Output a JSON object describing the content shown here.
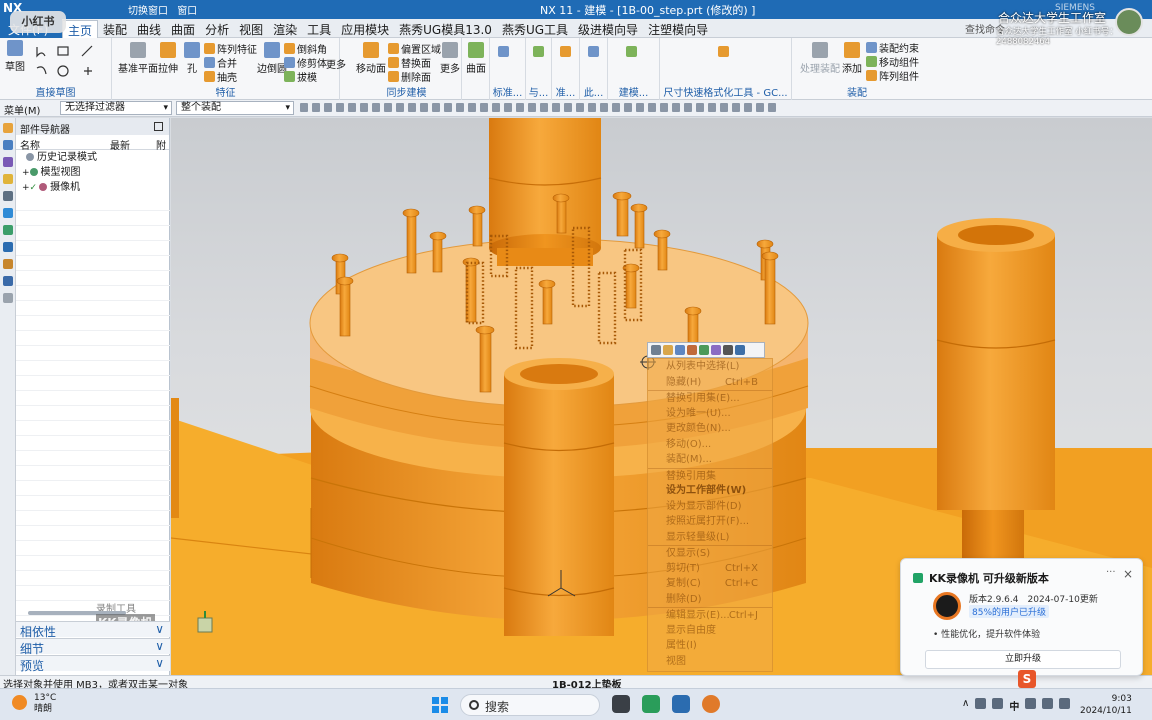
{
  "titlebar": {
    "logo": "NX",
    "quick_access": [
      "切换窗口",
      "窗口"
    ],
    "title": "NX 11 - 建模 - [1B-00_step.prt  (修改的) ]",
    "brand": "SIEMENS"
  },
  "menu": {
    "file": "文件(F)",
    "tabs": [
      {
        "label": "主页",
        "active": true
      },
      {
        "label": "装配"
      },
      {
        "label": "曲线"
      },
      {
        "label": "曲面"
      },
      {
        "label": "分析"
      },
      {
        "label": "视图"
      },
      {
        "label": "渲染"
      },
      {
        "label": "工具"
      },
      {
        "label": "应用模块"
      },
      {
        "label": "燕秀UG模具13.0"
      },
      {
        "label": "燕秀UG工具"
      },
      {
        "label": "级进模向导"
      },
      {
        "label": "注塑模向导"
      }
    ],
    "find_command": "查找命令"
  },
  "ribbon": {
    "sketch_group": {
      "name": "直接草图",
      "sketch": "草图"
    },
    "feature_group": {
      "name": "特征",
      "datum_plane": "基准平面",
      "extrude": "拉伸",
      "hole": "孔",
      "pattern_feature": "阵列特征",
      "unite": "合并",
      "shell": "抽壳",
      "edge_blend": "边倒圆",
      "chamfer": "倒斜角",
      "trim_body": "修剪体",
      "draft": "拔模",
      "more": "更多"
    },
    "sync_group": {
      "name": "同步建模",
      "move_face": "移动面",
      "offset_region": "偏置区域",
      "replace_face": "替换面",
      "delete_face": "删除面",
      "more": "更多"
    },
    "surface_group": {
      "surface": "曲面"
    },
    "small_groups": [
      "标准...",
      "与...",
      "准...",
      "此...",
      "建模...",
      "尺寸快速格式化工具 - GC..."
    ],
    "assembly_group": {
      "name": "装配",
      "wave": "WAVE",
      "process_assembly": "处理装配",
      "add": "添加",
      "assembly_constraints": "装配约束",
      "move_component": "移动组件",
      "pattern_component": "阵列组件"
    }
  },
  "selbar": {
    "menu": "菜单(M)",
    "filter": "无选择过滤器",
    "scope": "整个装配"
  },
  "navigator": {
    "title": "部件导航器",
    "columns": {
      "name": "名称",
      "latest": "最新",
      "attached": "附"
    },
    "rows": [
      {
        "label": "历史记录模式"
      },
      {
        "label": "模型视图"
      },
      {
        "label": "摄像机"
      }
    ],
    "watermark_top": "录制工具",
    "watermark_bottom": "KK录像机",
    "panels": [
      "相依性",
      "细节",
      "预览"
    ]
  },
  "context_menu": {
    "items": [
      {
        "label": "从列表中选择(L)",
        "shortcut": ""
      },
      {
        "label": "隐藏(H)",
        "shortcut": "Ctrl+B"
      },
      {
        "label": "替换引用集(E)...",
        "shortcut": ""
      },
      {
        "label": "设为唯一(U)...",
        "shortcut": ""
      },
      {
        "label": "更改颜色(N)...",
        "shortcut": ""
      },
      {
        "label": "移动(O)...",
        "shortcut": ""
      },
      {
        "label": "装配(M)...",
        "shortcut": ""
      },
      {
        "label": "替换引用集",
        "shortcut": ""
      },
      {
        "label": "设为工作部件(W)",
        "shortcut": ""
      },
      {
        "label": "设为显示部件(D)",
        "shortcut": ""
      },
      {
        "label": "按照近属打开(F)...",
        "shortcut": ""
      },
      {
        "label": "显示轻量级(L)",
        "shortcut": ""
      },
      {
        "label": "仅显示(S)",
        "shortcut": ""
      },
      {
        "label": "剪切(T)",
        "shortcut": "Ctrl+X"
      },
      {
        "label": "复制(C)",
        "shortcut": "Ctrl+C"
      },
      {
        "label": "删除(D)",
        "shortcut": ""
      },
      {
        "label": "编辑显示(E)...",
        "shortcut": "Ctrl+J"
      },
      {
        "label": "显示自由度",
        "shortcut": ""
      },
      {
        "label": "属性(I)",
        "shortcut": ""
      },
      {
        "label": "视图",
        "shortcut": ""
      }
    ]
  },
  "statusbar": {
    "prompt": "选择对象并使用 MB3，或者双击某一对象",
    "part_name": "1B-012上垫板"
  },
  "notification": {
    "title": "KK录像机 可升级新版本",
    "more": "···",
    "close": "×",
    "version": "版本2.9.6.4",
    "date": "2024-07-10更新",
    "upgrade_ratio": "85%的用户已升级",
    "feature": "• 性能优化，提升软件体验",
    "button": "立即升级"
  },
  "taskbar": {
    "weather_temp": "13°C",
    "weather_desc": "晴朗",
    "search_placeholder": "搜索",
    "time": "9:03",
    "date": "2024/10/11",
    "ime": "中"
  },
  "overlays": {
    "xiaohongshu": "小红书",
    "studio_name": "合众达大学生工作室",
    "studio_id": "合众达大学生工作室 小红书号：2488082464"
  },
  "colors": {
    "part_orange": "#f39c20",
    "part_light_orange": "#f7b55a",
    "accent_blue": "#1f6bb5"
  }
}
